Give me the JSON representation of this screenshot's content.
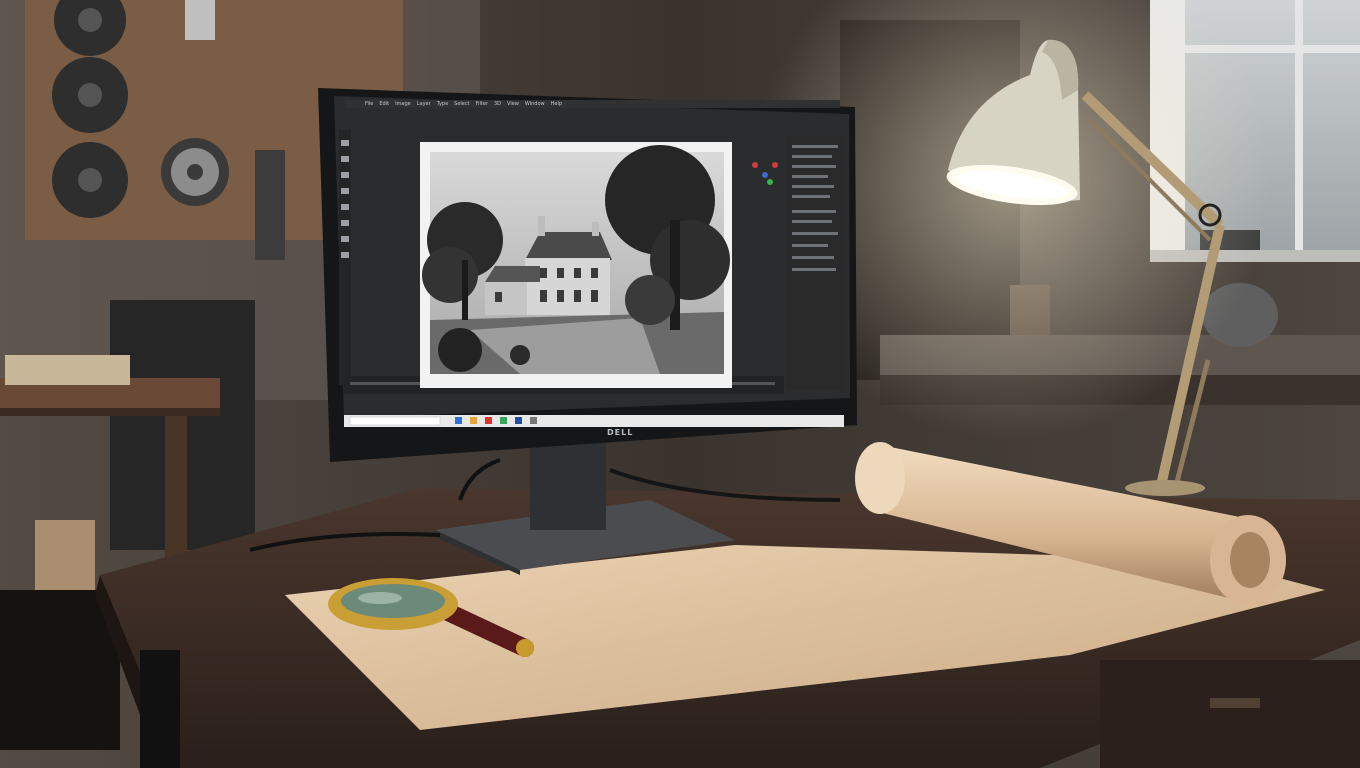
{
  "monitor": {
    "brand": "DELL",
    "app": {
      "menu_items": [
        "File",
        "Edit",
        "Image",
        "Layer",
        "Type",
        "Select",
        "Filter",
        "3D",
        "View",
        "Window",
        "Help"
      ],
      "tool_icons": [
        "move-icon",
        "marquee-icon",
        "lasso-icon",
        "crop-icon",
        "eyedropper-icon",
        "brush-icon",
        "eraser-icon",
        "gradient-icon",
        "pen-icon",
        "text-icon",
        "hand-icon",
        "zoom-icon"
      ],
      "canvas_image": "black and white photo of a country house with trees"
    },
    "taskbar": {
      "search_placeholder": ""
    }
  },
  "objects": [
    "pegboard-with-film-reels",
    "desk-lamp",
    "paper-roll",
    "magnifying-glass",
    "window",
    "workbench"
  ],
  "colors": {
    "lamp_light": "#fff6df",
    "wood": "#3c2c24",
    "paper": "#e3c7a3"
  }
}
